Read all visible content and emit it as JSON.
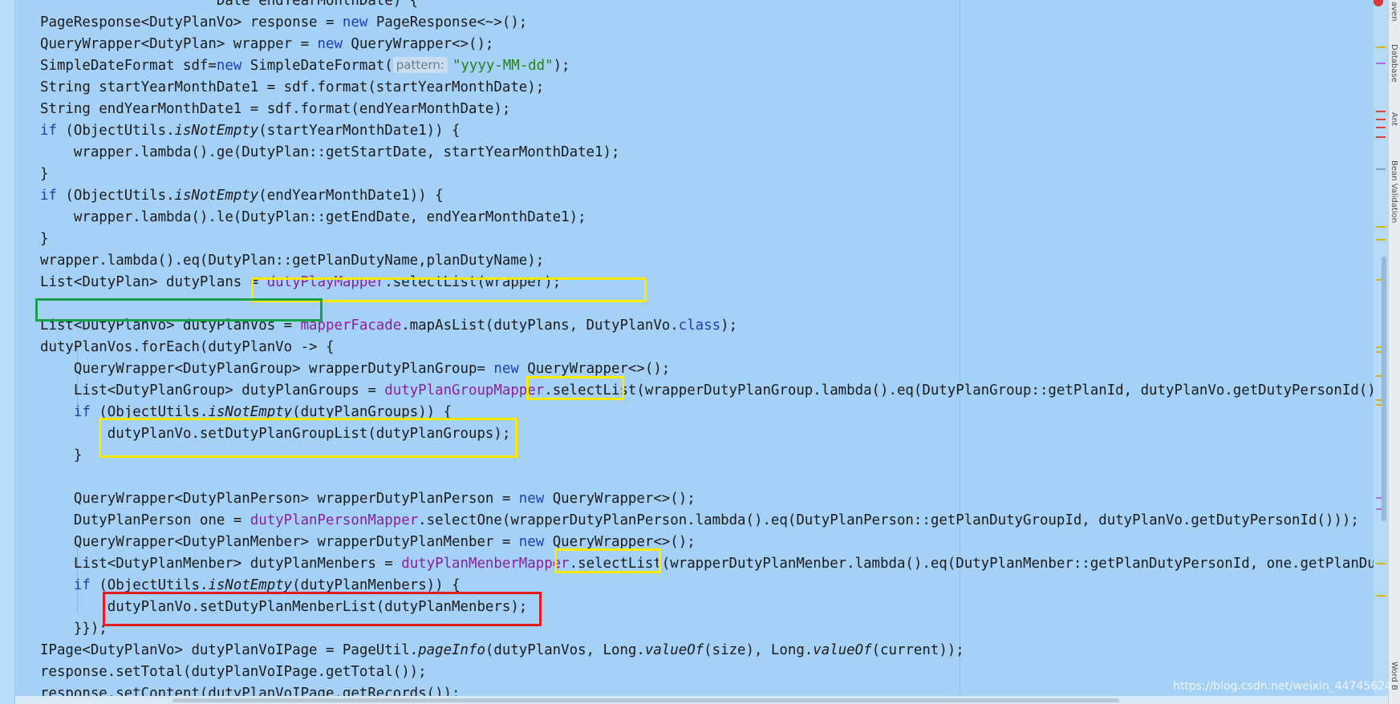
{
  "editor": {
    "lines": [
      {
        "tokens": [
          {
            "t": "                     Date endYearMonthDate) {"
          }
        ]
      },
      {
        "tokens": [
          {
            "t": "PageResponse<DutyPlanVo> response = "
          },
          {
            "t": "new",
            "c": "kw"
          },
          {
            "t": " PageResponse<~>();"
          }
        ]
      },
      {
        "tokens": [
          {
            "t": "QueryWrapper<DutyPlan> wrapper = "
          },
          {
            "t": "new",
            "c": "kw"
          },
          {
            "t": " QueryWrapper<>();"
          }
        ]
      },
      {
        "tokens": [
          {
            "t": "SimpleDateFormat sdf="
          },
          {
            "t": "new",
            "c": "kw"
          },
          {
            "t": " SimpleDateFormat("
          },
          {
            "t": "pattern:",
            "c": "hint"
          },
          {
            "t": "\"yyyy-MM-dd\"",
            "c": "str"
          },
          {
            "t": ");"
          }
        ]
      },
      {
        "tokens": [
          {
            "t": "String startYearMonthDate1 = sdf.format(startYearMonthDate);"
          }
        ]
      },
      {
        "tokens": [
          {
            "t": "String endYearMonthDate1 = sdf.format(endYearMonthDate);"
          }
        ]
      },
      {
        "tokens": [
          {
            "t": "if",
            "c": "kw"
          },
          {
            "t": " (ObjectUtils."
          },
          {
            "t": "isNotEmpty",
            "c": "it"
          },
          {
            "t": "(startYearMonthDate1)) {"
          }
        ]
      },
      {
        "tokens": [
          {
            "t": "    wrapper.lambda().ge(DutyPlan::getStartDate, startYearMonthDate1);"
          }
        ]
      },
      {
        "tokens": [
          {
            "t": "}"
          }
        ]
      },
      {
        "tokens": [
          {
            "t": "if",
            "c": "kw"
          },
          {
            "t": " (ObjectUtils."
          },
          {
            "t": "isNotEmpty",
            "c": "it"
          },
          {
            "t": "(endYearMonthDate1)) {"
          }
        ]
      },
      {
        "tokens": [
          {
            "t": "    wrapper.lambda().le(DutyPlan::getEndDate, endYearMonthDate1);"
          }
        ]
      },
      {
        "tokens": [
          {
            "t": "}"
          }
        ]
      },
      {
        "tokens": [
          {
            "t": "wrapper.lambda().eq(DutyPlan::getPlanDutyName,planDutyName);"
          }
        ]
      },
      {
        "tokens": [
          {
            "t": "List<DutyPlan> dutyPlans = "
          },
          {
            "t": "dutyPlayMapper",
            "c": "fld"
          },
          {
            "t": ".selectList(wrapper);"
          }
        ]
      },
      {
        "tokens": [
          {
            "t": ""
          }
        ]
      },
      {
        "tokens": [
          {
            "t": "List<DutyPlanVo> dutyPlanVos = "
          },
          {
            "t": "mapperFacade",
            "c": "fld"
          },
          {
            "t": ".mapAsList(dutyPlans, DutyPlanVo."
          },
          {
            "t": "class",
            "c": "kw"
          },
          {
            "t": ");"
          }
        ]
      },
      {
        "tokens": [
          {
            "t": "dutyPlanVos.forEach(dutyPlanVo -> {"
          }
        ]
      },
      {
        "tokens": [
          {
            "t": "    QueryWrapper<DutyPlanGroup> wrapperDutyPlanGroup= "
          },
          {
            "t": "new",
            "c": "kw"
          },
          {
            "t": " QueryWrapper<>();"
          }
        ]
      },
      {
        "tokens": [
          {
            "t": "    List<DutyPlanGroup> dutyPlanGroups = "
          },
          {
            "t": "dutyPlanGroupMapper",
            "c": "fld"
          },
          {
            "t": ".selectList(wrapperDutyPlanGroup.lambda().eq(DutyPlanGroup::getPlanId, dutyPlanVo.getDutyPersonId()));"
          }
        ]
      },
      {
        "tokens": [
          {
            "t": "    "
          },
          {
            "t": "if",
            "c": "kw"
          },
          {
            "t": " (ObjectUtils."
          },
          {
            "t": "isNotEmpty",
            "c": "it"
          },
          {
            "t": "(dutyPlanGroups)) {"
          }
        ]
      },
      {
        "tokens": [
          {
            "t": "        dutyPlanVo.setDutyPlanGroupList(dutyPlanGroups);"
          }
        ]
      },
      {
        "tokens": [
          {
            "t": "    }"
          }
        ]
      },
      {
        "tokens": [
          {
            "t": ""
          }
        ]
      },
      {
        "tokens": [
          {
            "t": "    QueryWrapper<DutyPlanPerson> wrapperDutyPlanPerson = "
          },
          {
            "t": "new",
            "c": "kw"
          },
          {
            "t": " QueryWrapper<>();"
          }
        ]
      },
      {
        "tokens": [
          {
            "t": "    DutyPlanPerson one = "
          },
          {
            "t": "dutyPlanPersonMapper",
            "c": "fld"
          },
          {
            "t": ".selectOne(wrapperDutyPlanPerson.lambda().eq(DutyPlanPerson::getPlanDutyGroupId, dutyPlanVo.getDutyPersonId()));"
          }
        ]
      },
      {
        "tokens": [
          {
            "t": "    QueryWrapper<DutyPlanMenber> wrapperDutyPlanMenber = "
          },
          {
            "t": "new",
            "c": "kw"
          },
          {
            "t": " QueryWrapper<>();"
          }
        ]
      },
      {
        "tokens": [
          {
            "t": "    List<DutyPlanMenber> dutyPlanMenbers = "
          },
          {
            "t": "dutyPlanMenberMapper",
            "c": "fld"
          },
          {
            "t": ".selectList(wrapperDutyPlanMenber.lambda().eq(DutyPlanMenber::getPlanDutyPersonId, one.getPlanDutyPersonI"
          }
        ]
      },
      {
        "tokens": [
          {
            "t": "    "
          },
          {
            "t": "if",
            "c": "kw"
          },
          {
            "t": " (ObjectUtils."
          },
          {
            "t": "isNotEmpty",
            "c": "it"
          },
          {
            "t": "(dutyPlanMenbers)) {"
          }
        ]
      },
      {
        "tokens": [
          {
            "t": "        dutyPlanVo.setDutyPlanMenberList(dutyPlanMenbers);"
          }
        ]
      },
      {
        "tokens": [
          {
            "t": "    }});"
          }
        ]
      },
      {
        "tokens": [
          {
            "t": "IPage<DutyPlanVo> dutyPlanVoIPage = PageUtil."
          },
          {
            "t": "pageInfo",
            "c": "it"
          },
          {
            "t": "(dutyPlanVos, Long."
          },
          {
            "t": "valueOf",
            "c": "it"
          },
          {
            "t": "(size), Long."
          },
          {
            "t": "valueOf",
            "c": "it"
          },
          {
            "t": "(current));"
          }
        ]
      },
      {
        "tokens": [
          {
            "t": "response.setTotal(dutyPlanVoIPage.getTotal());"
          }
        ]
      },
      {
        "tokens": [
          {
            "t": "response.setContent(dutyPlanVoIPage.getRecords());"
          }
        ]
      }
    ]
  },
  "tool_window_labels": [
    "aven",
    "Database",
    "Ant",
    "Bean Validation",
    "Word B"
  ],
  "watermark": "https://blog.csdn.net/weixin_44745624",
  "annotation_colors": {
    "yellow": "#ffe900",
    "green": "#16a34a",
    "red": "#e11d1d"
  }
}
